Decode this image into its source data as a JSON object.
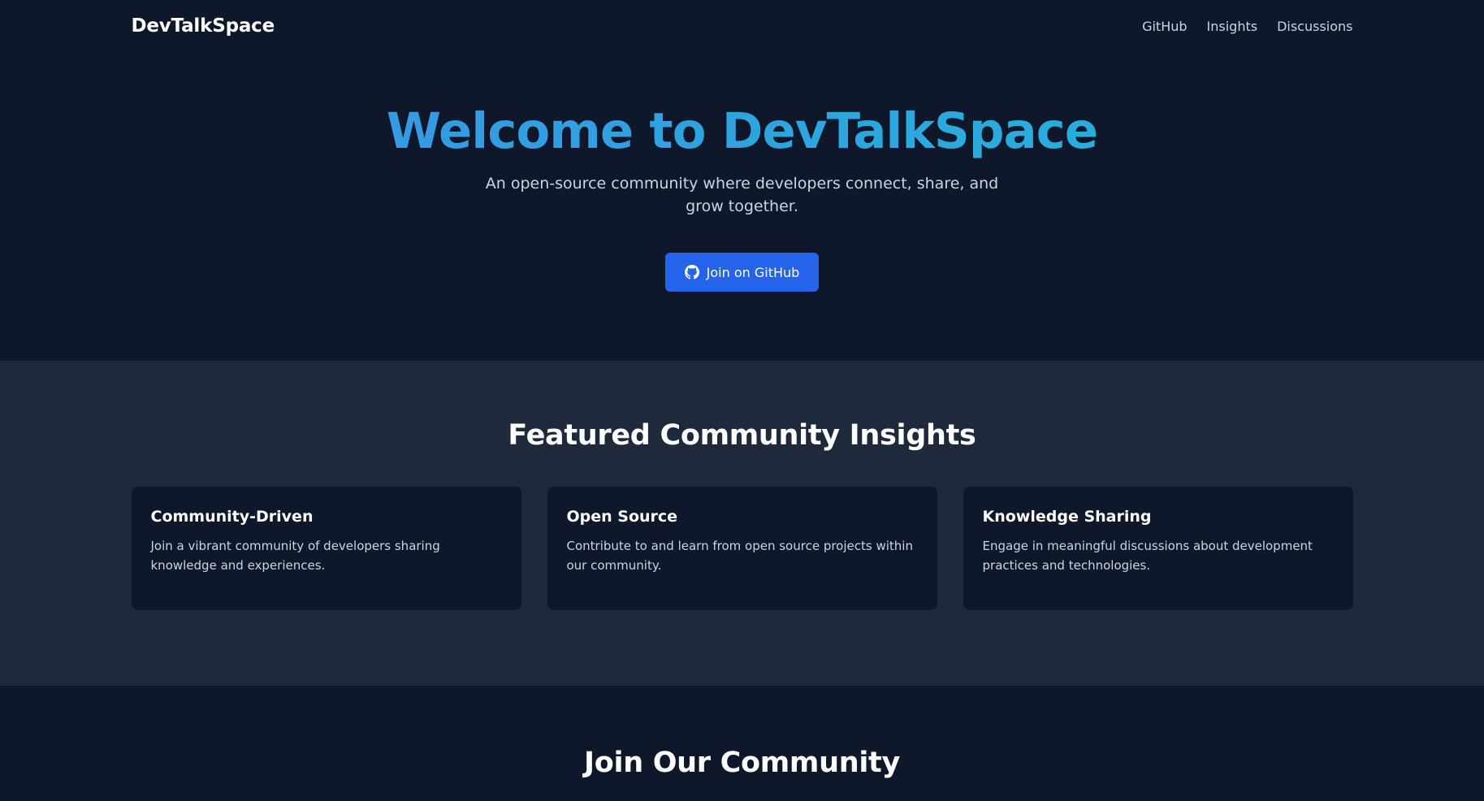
{
  "nav": {
    "brand": "DevTalkSpace",
    "links": [
      "GitHub",
      "Insights",
      "Discussions"
    ]
  },
  "hero": {
    "title": "Welcome to DevTalkSpace",
    "subtitle": "An open-source community where developers connect, share, and grow together.",
    "cta_label": "Join on GitHub",
    "cta_icon": "github-icon"
  },
  "featured": {
    "title": "Featured Community Insights",
    "cards": [
      {
        "title": "Community-Driven",
        "text": "Join a vibrant community of developers sharing knowledge and experiences."
      },
      {
        "title": "Open Source",
        "text": "Contribute to and learn from open source projects within our community."
      },
      {
        "title": "Knowledge Sharing",
        "text": "Engage in meaningful discussions about development practices and technologies."
      }
    ]
  },
  "join": {
    "title": "Join Our Community"
  },
  "colors": {
    "page_bg": "#0f172a",
    "section_bg": "#1e293b",
    "accent": "#2563eb",
    "title_gradient_start": "#3b8fe6",
    "title_gradient_end": "#22b8d8"
  }
}
